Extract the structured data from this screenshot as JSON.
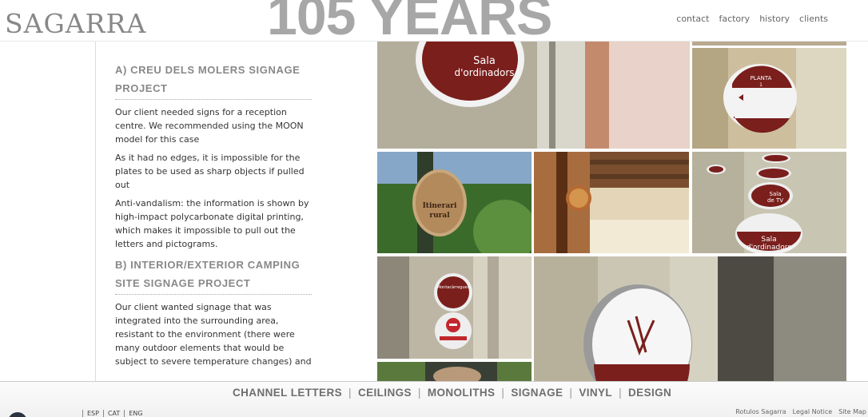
{
  "header": {
    "logo": "SAGARRA",
    "banner": "105 YEARS",
    "nav": [
      "contact",
      "factory",
      "history",
      "clients"
    ]
  },
  "article": {
    "cut_label": "SAGARRA",
    "section_a": {
      "title": "A) CREU DELS MOLERS SIGNAGE PROJECT",
      "paragraphs": [
        "Our client needed signs for a reception centre. We recommended using the MOON model for this case",
        "As it had no edges, it is impossible for the plates to be used as sharp objects if pulled out",
        "Anti-vandalism: the information is shown by high-impact polycarbonate digital printing, which makes it impossible to pull out the letters and pictograms."
      ]
    },
    "section_b": {
      "title": "B) INTERIOR/EXTERIOR CAMPING SITE SIGNAGE PROJECT",
      "paragraphs": [
        "Our client wanted signage that was integrated into the surrounding area, resistant to the environment (there were many outdoor elements that would be subject to severe temperature changes) and"
      ]
    }
  },
  "photos": {
    "sign1": [
      "Sala",
      "d'ordinadors"
    ],
    "sign2": [
      "PLANTA",
      "1"
    ],
    "sign3": [
      "Itinerari",
      "rural"
    ],
    "sign4": [
      "Sala",
      "d'ordinadors"
    ],
    "sign4_small": [
      "Sala",
      "de TV"
    ],
    "sign5": [
      "Montacàrregues"
    ]
  },
  "footer": {
    "categories": [
      "CHANNEL LETTERS",
      "CEILINGS",
      "MONOLITHS",
      "SIGNAGE",
      "VINYL",
      "DESIGN"
    ],
    "languages": [
      "ESP",
      "CAT",
      "ENG"
    ],
    "links": [
      "Rotulos Sagarra",
      "Legal Notice",
      "Site Map"
    ]
  },
  "colors": {
    "sign_red": "#7a1f1c",
    "banner_grey": "#a7a7a7"
  }
}
